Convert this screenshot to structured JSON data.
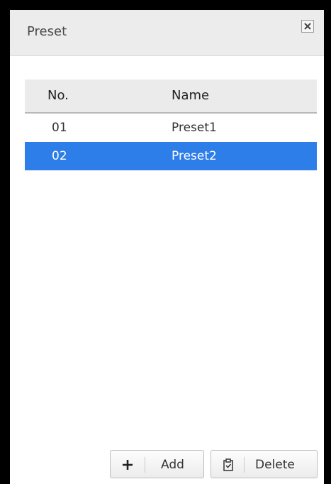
{
  "dialog": {
    "title": "Preset",
    "close_icon": "close-icon"
  },
  "table": {
    "columns": [
      "No.",
      "Name"
    ],
    "rows": [
      {
        "no": "01",
        "name": "Preset1",
        "selected": false
      },
      {
        "no": "02",
        "name": "Preset2",
        "selected": true
      }
    ]
  },
  "buttons": {
    "add_label": "Add",
    "add_icon": "plus-icon",
    "delete_label": "Delete",
    "delete_icon": "clipboard-check-icon"
  },
  "colors": {
    "selection": "#2d7ee9",
    "header_bg": "#ebebeb",
    "titlebar_bg": "#ececec"
  }
}
